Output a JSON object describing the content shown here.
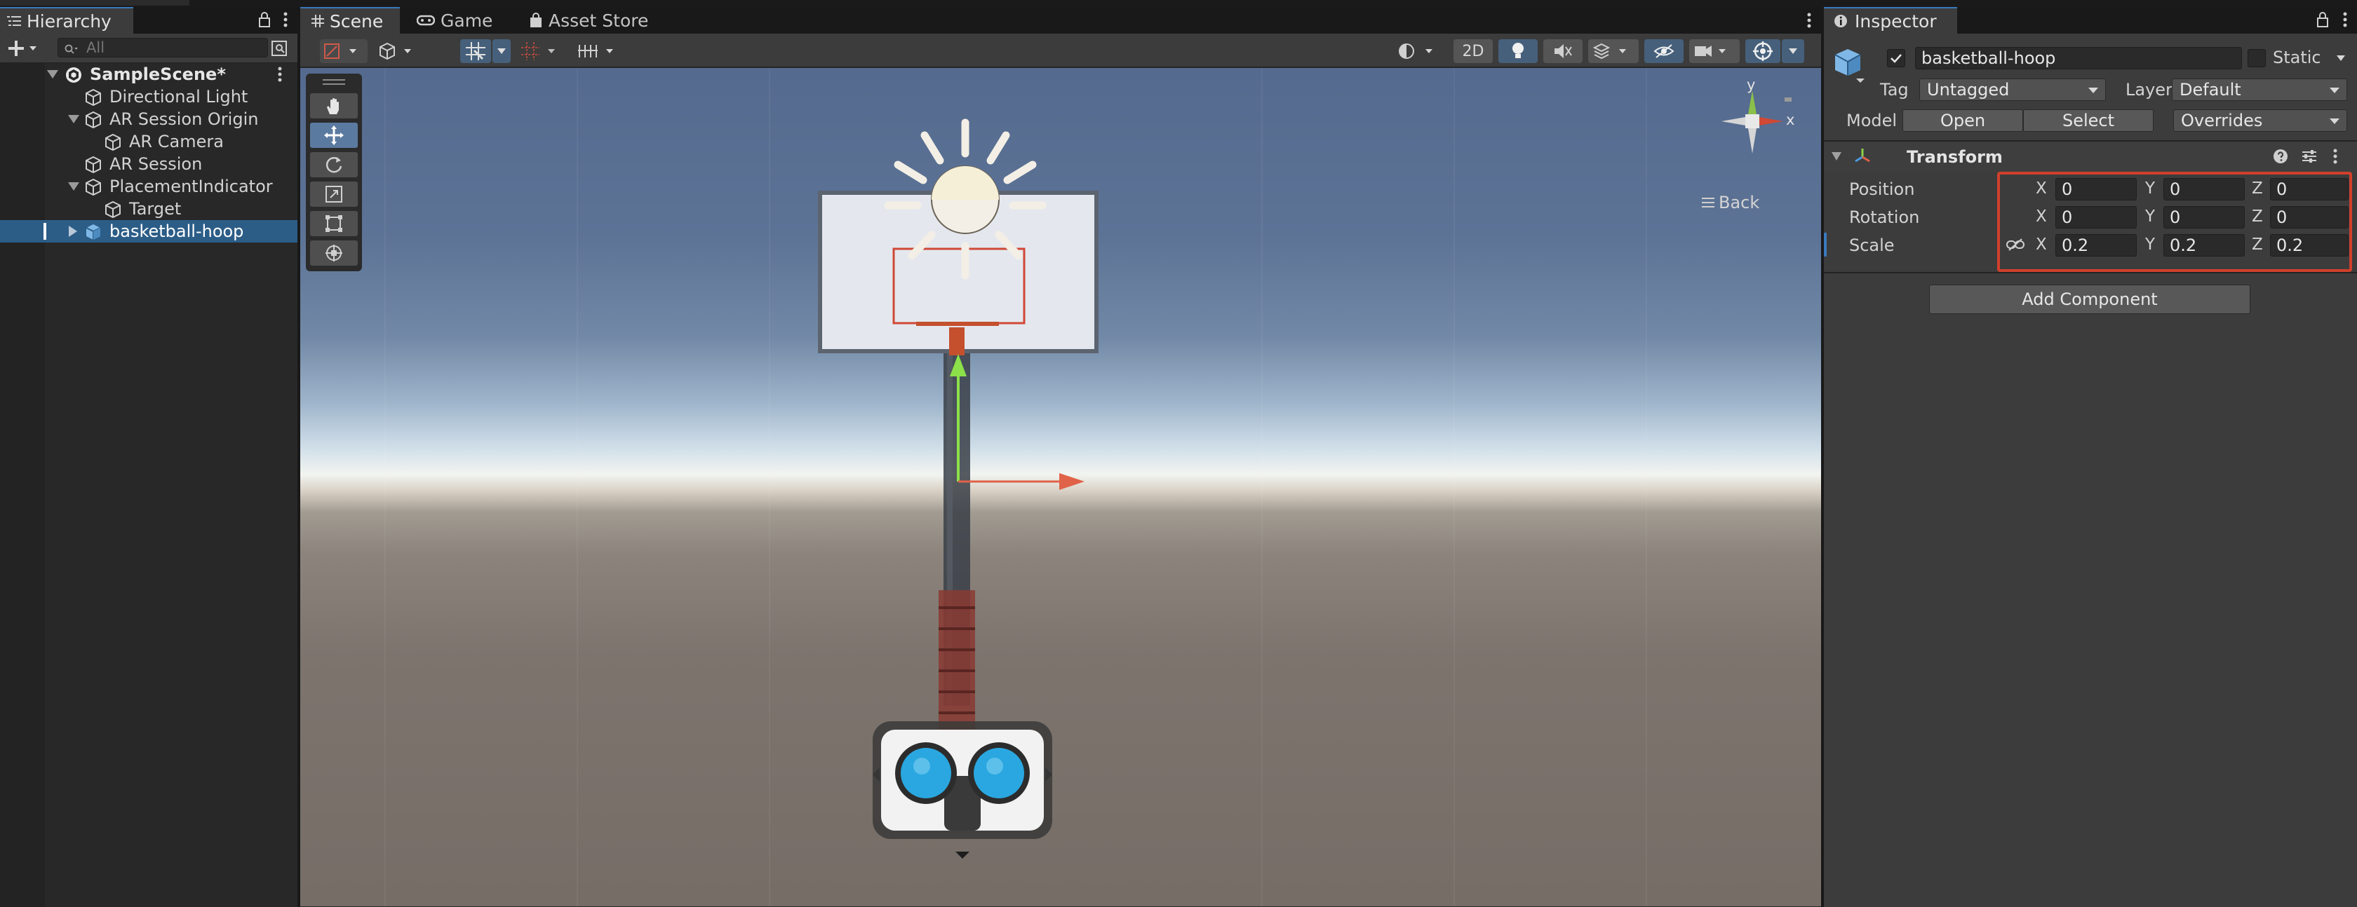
{
  "hierarchy": {
    "tab_label": "Hierarchy",
    "search_placeholder": "All",
    "scene_name": "SampleScene*",
    "items": [
      {
        "label": "Directional Light"
      },
      {
        "label": "AR Session Origin"
      },
      {
        "label": "AR Camera"
      },
      {
        "label": "AR Session"
      },
      {
        "label": "PlacementIndicator"
      },
      {
        "label": "Target"
      },
      {
        "label": "basketball-hoop"
      }
    ]
  },
  "scene": {
    "tabs": [
      {
        "label": "Scene",
        "icon": "grid-icon"
      },
      {
        "label": "Game",
        "icon": "gamepad-icon"
      },
      {
        "label": "Asset Store",
        "icon": "bag-icon"
      }
    ],
    "toolbar": {
      "mode_2d_label": "2D"
    },
    "gizmo": {
      "y_label": "y",
      "x_label": "x",
      "back_label": "Back"
    }
  },
  "inspector": {
    "tab_label": "Inspector",
    "object_name": "basketball-hoop",
    "static_label": "Static",
    "tag_label": "Tag",
    "tag_value": "Untagged",
    "layer_label": "Layer",
    "layer_value": "Default",
    "model_label": "Model",
    "open_label": "Open",
    "select_label": "Select",
    "overrides_label": "Overrides",
    "transform_label": "Transform",
    "position_label": "Position",
    "rotation_label": "Rotation",
    "scale_label": "Scale",
    "axis_x": "X",
    "axis_y": "Y",
    "axis_z": "Z",
    "position": {
      "x": "0",
      "y": "0",
      "z": "0"
    },
    "rotation": {
      "x": "0",
      "y": "0",
      "z": "0"
    },
    "scale": {
      "x": "0.2",
      "y": "0.2",
      "z": "0.2"
    },
    "add_component_label": "Add Component",
    "highlight_color": "#d0402b"
  },
  "colors": {
    "selection": "#2c5d87",
    "accent": "#3a79bb"
  }
}
